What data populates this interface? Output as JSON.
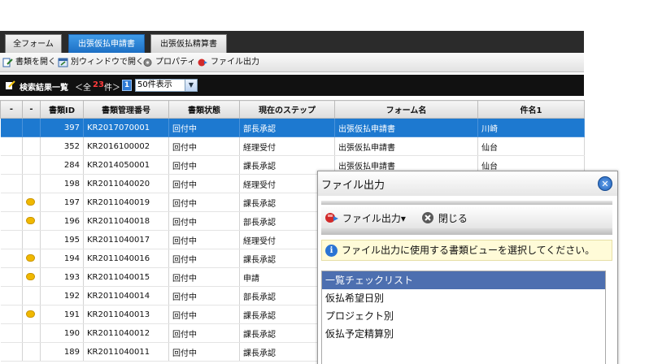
{
  "tabs": [
    "全フォーム",
    "出張仮払申請書",
    "出張仮払精算書"
  ],
  "toolbar": {
    "open_doc": "書類を開く",
    "open_window": "別ウィンドウで開く",
    "properties": "プロパティ",
    "file_output": "ファイル出力"
  },
  "results": {
    "title": "検索結果一覧",
    "count_open": "＜全",
    "count": "23",
    "count_close": "件＞",
    "page": "1",
    "per_page": "50件表示"
  },
  "table": {
    "headers": [
      "-",
      "-",
      "書類ID",
      "書類管理番号",
      "書類状態",
      "現在のステップ",
      "フォーム名",
      "件名1"
    ],
    "rows": [
      {
        "id": "397",
        "no": "KR2017070001",
        "state": "回付中",
        "step": "部長承認",
        "form": "出張仮払申請書",
        "subject": "川崎",
        "comment": false
      },
      {
        "id": "352",
        "no": "KR2016100002",
        "state": "回付中",
        "step": "経理受付",
        "form": "出張仮払申請書",
        "subject": "仙台",
        "comment": false
      },
      {
        "id": "284",
        "no": "KR2014050001",
        "state": "回付中",
        "step": "課長承認",
        "form": "出張仮払申請書",
        "subject": "仙台",
        "comment": false
      },
      {
        "id": "198",
        "no": "KR2011040020",
        "state": "回付中",
        "step": "経理受付",
        "form": "",
        "subject": "",
        "comment": false
      },
      {
        "id": "197",
        "no": "KR2011040019",
        "state": "回付中",
        "step": "課長承認",
        "form": "",
        "subject": "",
        "comment": true
      },
      {
        "id": "196",
        "no": "KR2011040018",
        "state": "回付中",
        "step": "部長承認",
        "form": "",
        "subject": "",
        "comment": true
      },
      {
        "id": "195",
        "no": "KR2011040017",
        "state": "回付中",
        "step": "経理受付",
        "form": "",
        "subject": "",
        "comment": false
      },
      {
        "id": "194",
        "no": "KR2011040016",
        "state": "回付中",
        "step": "課長承認",
        "form": "",
        "subject": "",
        "comment": true
      },
      {
        "id": "193",
        "no": "KR2011040015",
        "state": "回付中",
        "step": "申請",
        "form": "",
        "subject": "",
        "comment": true
      },
      {
        "id": "192",
        "no": "KR2011040014",
        "state": "回付中",
        "step": "部長承認",
        "form": "",
        "subject": "",
        "comment": false
      },
      {
        "id": "191",
        "no": "KR2011040013",
        "state": "回付中",
        "step": "課長承認",
        "form": "",
        "subject": "",
        "comment": true
      },
      {
        "id": "190",
        "no": "KR2011040012",
        "state": "回付中",
        "step": "課長承認",
        "form": "",
        "subject": "",
        "comment": false
      },
      {
        "id": "189",
        "no": "KR2011040011",
        "state": "回付中",
        "step": "課長承認",
        "form": "",
        "subject": "",
        "comment": false
      }
    ]
  },
  "dialog": {
    "title": "ファイル出力",
    "file_output_button": "ファイル出力▾",
    "close_button": "閉じる",
    "info": "ファイル出力に使用する書類ビューを選択してください。",
    "views": [
      "一覧チェックリスト",
      "仮払希望日別",
      "プロジェクト別",
      "仮払予定精算別"
    ]
  }
}
